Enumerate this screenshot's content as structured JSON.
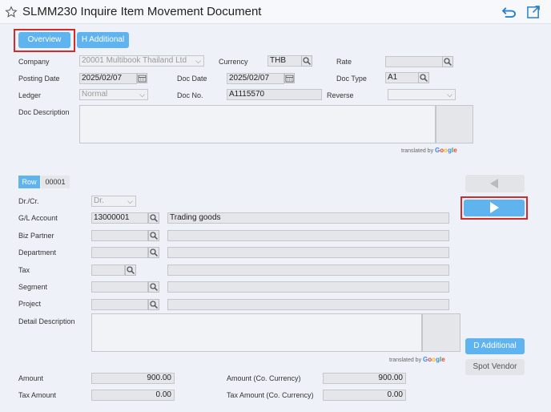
{
  "header": {
    "title": "SLMM230 Inquire Item Movement Document"
  },
  "tabs": {
    "overview": "Overview",
    "h_additional": "H Additional"
  },
  "head_fields": {
    "company_label": "Company",
    "company_value": "20001 Multibook Thailand Ltd",
    "currency_label": "Currency",
    "currency_value": "THB",
    "rate_label": "Rate",
    "rate_value": "",
    "posting_date_label": "Posting Date",
    "posting_date_value": "2025/02/07",
    "doc_date_label": "Doc Date",
    "doc_date_value": "2025/02/07",
    "doc_type_label": "Doc Type",
    "doc_type_value": "A1",
    "ledger_label": "Ledger",
    "ledger_value": "Normal",
    "doc_no_label": "Doc No.",
    "doc_no_value": "A1115570",
    "reverse_label": "Reverse",
    "reverse_value": "",
    "doc_description_label": "Doc Description"
  },
  "translated_by": "translated by",
  "google": [
    "G",
    "o",
    "o",
    "g",
    "l",
    "e"
  ],
  "row": {
    "label": "Row",
    "number": "00001"
  },
  "line_fields": {
    "drcr_label": "Dr./Cr.",
    "drcr_value": "Dr.",
    "gl_account_label": "G/L Account",
    "gl_account_value": "13000001",
    "gl_account_desc": "Trading goods",
    "biz_partner_label": "Biz Partner",
    "department_label": "Department",
    "tax_label": "Tax",
    "segment_label": "Segment",
    "project_label": "Project",
    "detail_description_label": "Detail Description"
  },
  "buttons": {
    "d_additional": "D Additional",
    "spot_vendor": "Spot Vendor"
  },
  "amounts": {
    "amount_label": "Amount",
    "amount_value": "900.00",
    "amount_co_label": "Amount (Co. Currency)",
    "amount_co_value": "900.00",
    "tax_amount_label": "Tax Amount",
    "tax_amount_value": "0.00",
    "tax_amount_co_label": "Tax Amount (Co. Currency)",
    "tax_amount_co_value": "0.00"
  },
  "colors": {
    "accent": "#5fb3ee",
    "highlight": "#d32b2b"
  }
}
